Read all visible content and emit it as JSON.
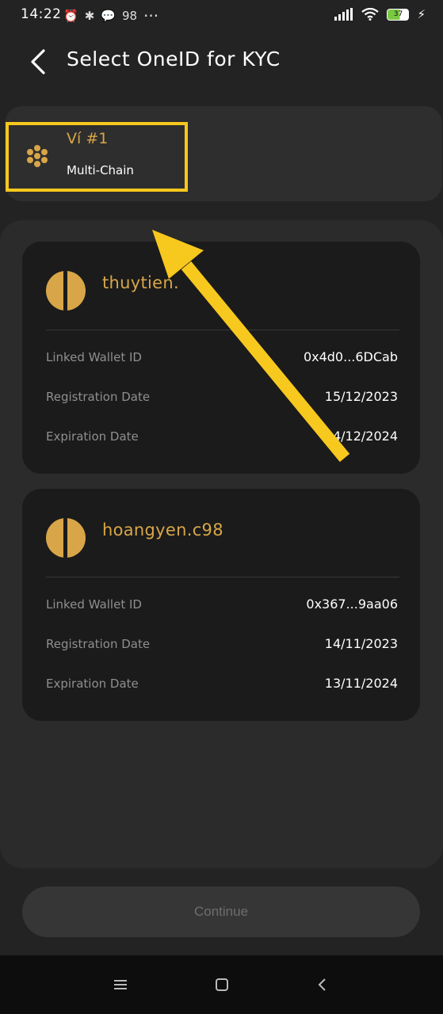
{
  "status_bar": {
    "time": "14:22",
    "extra_icons_text": "98",
    "dots": "···",
    "battery": "37"
  },
  "header": {
    "title": "Select OneID for KYC"
  },
  "wallet": {
    "name": "Ví #1",
    "chain": "Multi-Chain"
  },
  "ids": [
    {
      "handle": "thuytien.",
      "rows": [
        {
          "label": "Linked Wallet ID",
          "value": "0x4d0...6DCab"
        },
        {
          "label": "Registration Date",
          "value": "15/12/2023"
        },
        {
          "label": "Expiration Date",
          "value": "14/12/2024"
        }
      ]
    },
    {
      "handle": "hoangyen.c98",
      "rows": [
        {
          "label": "Linked Wallet ID",
          "value": "0x367...9aa06"
        },
        {
          "label": "Registration Date",
          "value": "14/11/2023"
        },
        {
          "label": "Expiration Date",
          "value": "13/11/2024"
        }
      ]
    }
  ],
  "footer": {
    "continue_label": "Continue"
  },
  "colors": {
    "accent": "#d8a648",
    "highlight": "#f7c81d",
    "background": "#232323"
  }
}
